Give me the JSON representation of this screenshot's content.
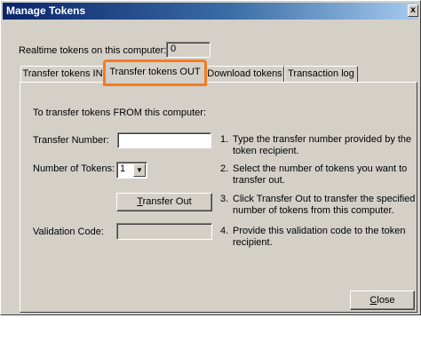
{
  "window": {
    "title": "Manage Tokens",
    "close_glyph": "x"
  },
  "realtime": {
    "label": "Realtime tokens on this computer:",
    "value": "0"
  },
  "tabs": [
    {
      "label": "Transfer tokens IN"
    },
    {
      "label": "Transfer tokens OUT"
    },
    {
      "label": "Download tokens"
    },
    {
      "label": "Transaction log"
    }
  ],
  "active_tab_highlight": "#f57c20",
  "panel": {
    "heading": "To transfer tokens FROM this computer:",
    "transfer_number_label": "Transfer Number:",
    "transfer_number_value": "",
    "tokens_label": "Number of Tokens:",
    "tokens_selected": "1",
    "transfer_out_button": {
      "mnemonic": "T",
      "rest": "ransfer Out"
    },
    "validation_label": "Validation Code:",
    "validation_value": "",
    "steps": [
      {
        "num": "1.",
        "text": "Type the transfer number provided by the token recipient."
      },
      {
        "num": "2.",
        "text": "Select the number of tokens you want to transfer out."
      },
      {
        "num": "3.",
        "text": "Click Transfer Out to transfer the specified number of tokens from this computer."
      },
      {
        "num": "4.",
        "text": "Provide this validation code to the token recipient."
      }
    ]
  },
  "close_button": {
    "mnemonic": "C",
    "rest": "lose"
  }
}
